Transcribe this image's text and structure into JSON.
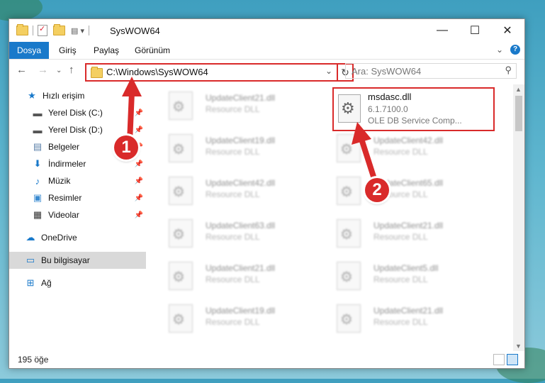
{
  "window": {
    "title": "SysWOW64",
    "controls": {
      "minimize": "—",
      "maximize": "☐",
      "close": "✕"
    }
  },
  "ribbon": {
    "tabs": [
      {
        "label": "Dosya",
        "active": true
      },
      {
        "label": "Giriş"
      },
      {
        "label": "Paylaş"
      },
      {
        "label": "Görünüm"
      }
    ],
    "help": "?"
  },
  "addressbar": {
    "path": "C:\\Windows\\SysWOW64",
    "search_placeholder": "Ara: SysWOW64"
  },
  "sidebar": {
    "items": [
      {
        "label": "Hızlı erişim",
        "icon": "star-icon",
        "pinned": false
      },
      {
        "label": "Yerel Disk (C:)",
        "icon": "drive-icon",
        "pinned": true
      },
      {
        "label": "Yerel Disk (D:)",
        "icon": "drive-icon",
        "pinned": true
      },
      {
        "label": "Belgeler",
        "icon": "documents-icon",
        "pinned": true
      },
      {
        "label": "İndirmeler",
        "icon": "download-icon",
        "pinned": true
      },
      {
        "label": "Müzik",
        "icon": "music-icon",
        "pinned": true
      },
      {
        "label": "Resimler",
        "icon": "pictures-icon",
        "pinned": true
      },
      {
        "label": "Videolar",
        "icon": "video-icon",
        "pinned": true
      },
      {
        "label": "OneDrive",
        "icon": "cloud-icon"
      },
      {
        "label": "Bu bilgisayar",
        "icon": "computer-icon",
        "selected": true
      },
      {
        "label": "Ağ",
        "icon": "network-icon"
      }
    ]
  },
  "files": {
    "highlighted": {
      "name": "msdasc.dll",
      "version": "6.1.7100.0",
      "description": "OLE DB Service Comp..."
    },
    "left_column": [
      {
        "name": "UpdateClient21.dll",
        "description": "Resource DLL"
      },
      {
        "name": "UpdateClient19.dll",
        "description": "Resource DLL"
      },
      {
        "name": "UpdateClient42.dll",
        "description": "Resource DLL"
      },
      {
        "name": "UpdateClient63.dll",
        "description": "Resource DLL"
      },
      {
        "name": "UpdateClient21.dll",
        "description": "Resource DLL"
      },
      {
        "name": "UpdateClient19.dll",
        "description": "Resource DLL"
      }
    ],
    "right_column": [
      {
        "name": "UpdateClient42.dll",
        "description": "Resource DLL"
      },
      {
        "name": "UpdateClient65.dll",
        "description": "Resource DLL"
      },
      {
        "name": "UpdateClient21.dll",
        "description": "Resource DLL"
      },
      {
        "name": "UpdateClient5.dll",
        "description": "Resource DLL"
      },
      {
        "name": "UpdateClient21.dll",
        "description": "Resource DLL"
      }
    ]
  },
  "status": {
    "item_count": "195 öğe"
  },
  "annotations": {
    "step1": "1",
    "step2": "2",
    "color": "#d92a2a"
  }
}
